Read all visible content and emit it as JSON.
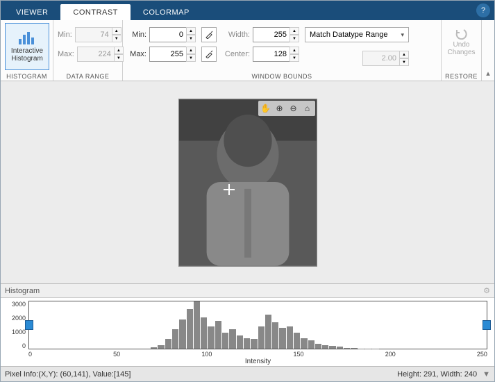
{
  "tabs": {
    "viewer": "VIEWER",
    "contrast": "CONTRAST",
    "colormap": "COLORMAP"
  },
  "histogram_btn": {
    "line1": "Interactive",
    "line2": "Histogram"
  },
  "sections": {
    "histogram": "HISTOGRAM",
    "dataRange": "DATA RANGE",
    "windowBounds": "WINDOW BOUNDS",
    "restore": "RESTORE"
  },
  "dataRange": {
    "minLabel": "Min:",
    "maxLabel": "Max:",
    "min": "74",
    "max": "224"
  },
  "window": {
    "minLabel": "Min:",
    "maxLabel": "Max:",
    "min": "0",
    "max": "255",
    "widthLabel": "Width:",
    "centerLabel": "Center:",
    "width": "255",
    "center": "128",
    "rangeOption": "Match Datatype Range",
    "gamma": "2.00"
  },
  "undo": {
    "line1": "Undo",
    "line2": "Changes"
  },
  "histPanel": {
    "title": "Histogram",
    "xlabel": "Intensity",
    "yTicks": [
      "3000",
      "2000",
      "1000",
      "0"
    ],
    "xTicks": [
      "0",
      "50",
      "100",
      "150",
      "200",
      "250"
    ]
  },
  "status": {
    "pixel": "Pixel Info:(X,Y): (60,141), Value:[145]",
    "dims": "Height: 291, Width: 240"
  },
  "chart_data": {
    "type": "bar",
    "title": "Histogram",
    "xlabel": "Intensity",
    "ylabel": "",
    "xlim": [
      0,
      255
    ],
    "ylim": [
      0,
      3200
    ],
    "x": [
      0,
      4,
      8,
      12,
      16,
      20,
      24,
      28,
      32,
      36,
      40,
      44,
      48,
      52,
      56,
      60,
      64,
      68,
      72,
      76,
      80,
      84,
      88,
      92,
      96,
      100,
      104,
      108,
      112,
      116,
      120,
      124,
      128,
      132,
      136,
      140,
      144,
      148,
      152,
      156,
      160,
      164,
      168,
      172,
      176,
      180,
      184,
      188,
      192,
      196,
      200,
      204,
      208,
      212,
      216,
      220,
      224,
      228,
      232,
      236,
      240,
      244,
      248,
      252
    ],
    "y": [
      0,
      0,
      0,
      0,
      0,
      0,
      0,
      0,
      0,
      0,
      0,
      0,
      0,
      0,
      0,
      0,
      0,
      80,
      220,
      650,
      1300,
      2000,
      2700,
      3200,
      2100,
      1500,
      1900,
      1100,
      1300,
      900,
      700,
      650,
      1500,
      2300,
      1800,
      1400,
      1500,
      1100,
      700,
      550,
      350,
      250,
      180,
      120,
      60,
      30,
      15,
      8,
      4,
      2,
      1,
      1,
      1,
      1,
      1,
      1,
      1,
      0,
      0,
      0,
      0,
      0,
      0,
      0
    ]
  }
}
